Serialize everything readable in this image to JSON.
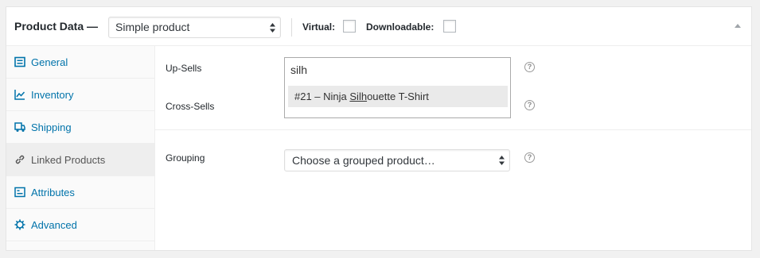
{
  "header": {
    "title": "Product Data —",
    "product_type": "Simple product",
    "virtual_label": "Virtual:",
    "virtual_checked": false,
    "downloadable_label": "Downloadable:",
    "downloadable_checked": false
  },
  "sidebar": {
    "items": [
      {
        "label": "General",
        "icon": "general-icon",
        "active": false
      },
      {
        "label": "Inventory",
        "icon": "inventory-icon",
        "active": false
      },
      {
        "label": "Shipping",
        "icon": "shipping-icon",
        "active": false
      },
      {
        "label": "Linked Products",
        "icon": "link-icon",
        "active": true
      },
      {
        "label": "Attributes",
        "icon": "attributes-icon",
        "active": false
      },
      {
        "label": "Advanced",
        "icon": "gear-icon",
        "active": false
      }
    ]
  },
  "linked": {
    "upsells_label": "Up-Sells",
    "crosssells_label": "Cross-Sells",
    "grouping_label": "Grouping",
    "search_value": "silh",
    "result_prefix": "#21 – Ninja ",
    "result_match": "Silh",
    "result_suffix": "ouette T-Shirt",
    "grouping_value": "Choose a grouped product…",
    "help_glyph": "?"
  },
  "colors": {
    "link": "#0073aa",
    "active_tab_bg": "#eeeeee",
    "highlight_bg": "#eaeaea"
  }
}
